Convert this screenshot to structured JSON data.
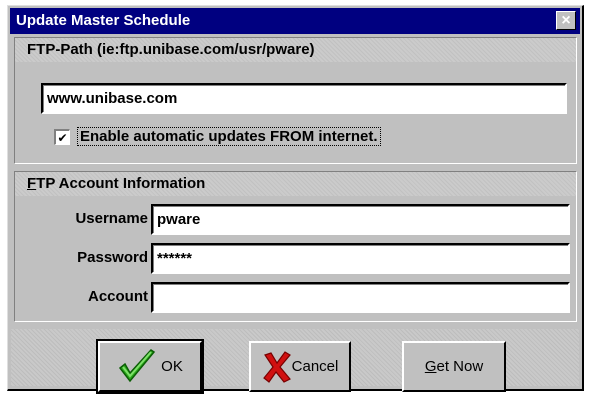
{
  "window": {
    "title": "Update Master Schedule",
    "close_glyph": "×"
  },
  "ftp_path": {
    "header": "FTP-Path (ie:ftp.unibase.com/usr/pware)",
    "value": "www.unibase.com",
    "checkbox": {
      "label": "Enable automatic updates FROM internet.",
      "checked": true,
      "glyph": "✔"
    }
  },
  "account": {
    "header_first": "F",
    "header_rest": "TP Account Information",
    "fields": [
      {
        "label": "Username",
        "value": "pware"
      },
      {
        "label": "Password",
        "value": "******"
      },
      {
        "label": "Account",
        "value": ""
      }
    ]
  },
  "buttons": {
    "ok": {
      "label": "OK",
      "icon": "green-check-icon"
    },
    "cancel": {
      "label": "Cancel",
      "icon": "red-x-icon"
    },
    "get_now": {
      "label_first": "G",
      "label_rest": "et Now"
    }
  },
  "colors": {
    "title_bar": "#000080",
    "face": "#c0c0c0",
    "ok_icon": "#2aa81a",
    "cancel_icon": "#d01010"
  }
}
